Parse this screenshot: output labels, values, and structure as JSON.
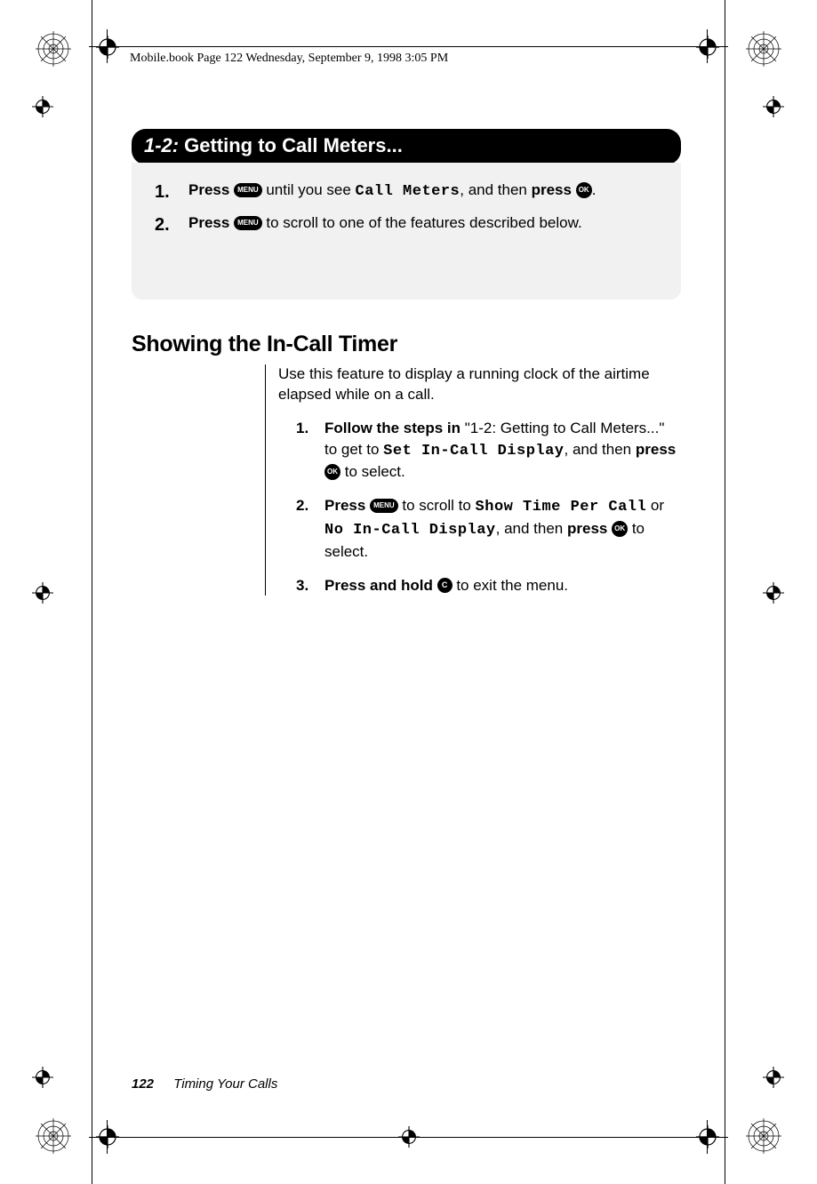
{
  "header": {
    "running_head": "Mobile.book  Page 122  Wednesday, September 9, 1998  3:05 PM"
  },
  "pill": {
    "number": "1-2:",
    "title": "Getting to Call Meters..."
  },
  "gray_steps": [
    {
      "num": "1.",
      "press_label": "Press",
      "menu_key": "MENU",
      "mid1": " until you see ",
      "lcd": "Call Meters",
      "mid2": ", and then ",
      "press_label2": "press",
      "ok_key": "OK",
      "tail": "."
    },
    {
      "num": "2.",
      "press_label": "Press",
      "menu_key": "MENU",
      "mid1": " to scroll to one of the features described below.",
      "lcd": "",
      "mid2": "",
      "press_label2": "",
      "ok_key": "",
      "tail": ""
    }
  ],
  "section_heading": "Showing the In-Call Timer",
  "intro_para": "Use this feature to display a running clock of the airtime elapsed while on a call.",
  "steps": [
    {
      "num": "1.",
      "lead_bold": "Follow the steps in ",
      "quote": "\"1-2: Getting to Call Meters...\" to get to ",
      "lcd1": "Set In-Call Display",
      "mid": ", and then ",
      "press": "press",
      "ok": "OK",
      "tail": " to select."
    },
    {
      "num": "2.",
      "lead_bold": "Press",
      "menu": "MENU",
      "mid1": " to scroll to ",
      "lcd1": "Show Time Per Call",
      "mid2": " or ",
      "lcd2": "No In-Call Display",
      "mid3": ", and then ",
      "press": "press",
      "ok": "OK",
      "tail": " to select."
    },
    {
      "num": "3.",
      "lead_bold": "Press and hold ",
      "c_key": "C",
      "tail": " to exit the menu."
    }
  ],
  "footer": {
    "page_number": "122",
    "chapter": "Timing Your Calls"
  }
}
